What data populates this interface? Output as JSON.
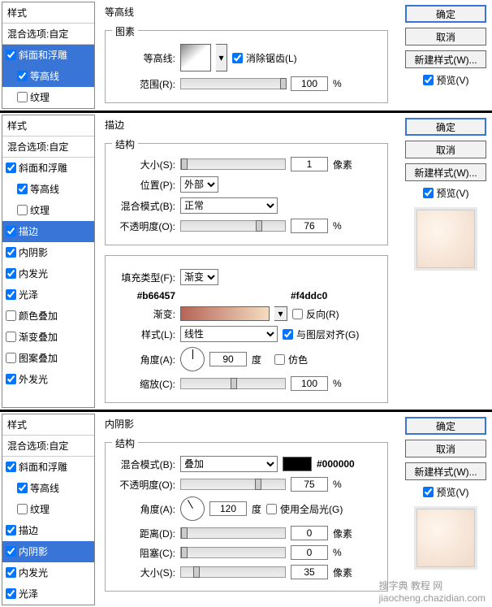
{
  "common": {
    "styles_head": "样式",
    "blend_options": "混合选项:自定",
    "buttons": {
      "ok": "确定",
      "cancel": "取消",
      "new_style": "新建样式(W)...",
      "preview": "预览(V)"
    }
  },
  "panel1": {
    "title": "等高线",
    "group": "图素",
    "contour_label": "等高线:",
    "antialias": "消除锯齿(L)",
    "range_label": "范围(R):",
    "range_value": "100",
    "pct": "%",
    "sidebar": [
      "斜面和浮雕",
      "等高线",
      "纹理"
    ]
  },
  "panel2": {
    "title": "描边",
    "group": "结构",
    "size_label": "大小(S):",
    "size_value": "1",
    "px": "像素",
    "pos_label": "位置(P):",
    "pos_value": "外部",
    "blend_label": "混合模式(B):",
    "blend_value": "正常",
    "opacity_label": "不透明度(O):",
    "opacity_value": "76",
    "pct": "%",
    "fill_type_label": "填充类型(F):",
    "fill_type_value": "渐变",
    "hex_left": "#b66457",
    "hex_right": "#f4ddc0",
    "grad_label": "渐变:",
    "reverse": "反向(R)",
    "style_label": "样式(L):",
    "style_value": "线性",
    "align_layer": "与图层对齐(G)",
    "angle_label": "角度(A):",
    "angle_value": "90",
    "deg": "度",
    "dither": "仿色",
    "scale_label": "缩放(C):",
    "scale_value": "100",
    "sidebar": [
      "斜面和浮雕",
      "等高线",
      "纹理",
      "描边",
      "内阴影",
      "内发光",
      "光泽",
      "颜色叠加",
      "渐变叠加",
      "图案叠加",
      "外发光"
    ]
  },
  "panel3": {
    "title": "内阴影",
    "group": "结构",
    "blend_label": "混合模式(B):",
    "blend_value": "叠加",
    "hex": "#000000",
    "opacity_label": "不透明度(O):",
    "opacity_value": "75",
    "pct": "%",
    "angle_label": "角度(A):",
    "angle_value": "120",
    "deg": "度",
    "global_light": "使用全局光(G)",
    "distance_label": "距离(D):",
    "distance_value": "0",
    "px": "像素",
    "choke_label": "阻塞(C):",
    "choke_value": "0",
    "size_label": "大小(S):",
    "size_value": "35",
    "sidebar": [
      "斜面和浮雕",
      "等高线",
      "纹理",
      "描边",
      "内阴影",
      "内发光",
      "光泽"
    ]
  },
  "watermark": "搜字典 教程 网",
  "watermark_url": "jiaocheng.chazidian.com"
}
